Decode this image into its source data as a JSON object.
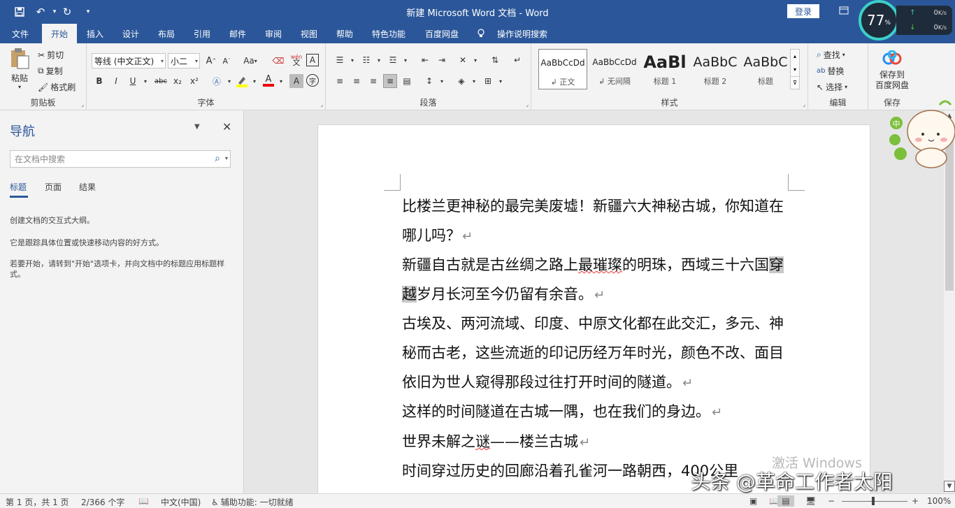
{
  "titlebar": {
    "title": "新建 Microsoft Word 文档  -  Word",
    "login_label": "登录",
    "qa_icons": [
      "save-icon",
      "undo-icon",
      "redo-icon",
      "customize-icon"
    ]
  },
  "speed_widget": {
    "value": "77",
    "unit": "%",
    "upload": "0",
    "upload_unit": "K/s",
    "download": "0",
    "download_unit": "K/s"
  },
  "tabs": [
    {
      "label": "文件"
    },
    {
      "label": "开始",
      "active": true
    },
    {
      "label": "插入"
    },
    {
      "label": "设计"
    },
    {
      "label": "布局"
    },
    {
      "label": "引用"
    },
    {
      "label": "邮件"
    },
    {
      "label": "审阅"
    },
    {
      "label": "视图"
    },
    {
      "label": "帮助"
    },
    {
      "label": "特色功能"
    },
    {
      "label": "百度网盘"
    },
    {
      "label": "操作说明搜索"
    }
  ],
  "ribbon": {
    "clipboard": {
      "group_label": "剪贴板",
      "paste": "粘贴",
      "cut": "剪切",
      "copy": "复制",
      "format_painter": "格式刷"
    },
    "font": {
      "group_label": "字体",
      "font_name": "等线 (中文正文)",
      "font_size": "小二",
      "change_case": "Aa",
      "bold": "B",
      "italic": "I",
      "underline": "U",
      "strike": "abc",
      "sub": "x₂",
      "sup": "x²",
      "grow": "A",
      "shrink": "A",
      "phonetic": "wén",
      "border_char": "A"
    },
    "paragraph": {
      "group_label": "段落"
    },
    "styles": {
      "group_label": "样式",
      "items": [
        {
          "sample": "AaBbCcDd",
          "name": "↲ 正文"
        },
        {
          "sample": "AaBbCcDd",
          "name": "↲ 无间隔"
        },
        {
          "sample": "AaBl",
          "name": "标题 1"
        },
        {
          "sample": "AaBbC",
          "name": "标题 2"
        },
        {
          "sample": "AaBbC",
          "name": "标题"
        }
      ]
    },
    "editing": {
      "group_label": "编辑",
      "find": "查找",
      "replace": "替换",
      "select": "选择"
    },
    "save": {
      "group_label": "保存",
      "button": "保存到\n百度网盘",
      "line1": "保存到",
      "line2": "百度网盘"
    }
  },
  "nav": {
    "title": "导航",
    "search_placeholder": "在文档中搜索",
    "tabs": [
      "标题",
      "页面",
      "结果"
    ],
    "p1": "创建文档的交互式大纲。",
    "p2": "它是跟踪具体位置或快速移动内容的好方式。",
    "p3": "若要开始，请转到\"开始\"选项卡，并向文档中的标题应用标题样式。"
  },
  "document": {
    "p1": "比楼兰更神秘的最完美废墟！新疆六大神秘古城，你知道在哪儿吗？",
    "p2a": "新疆自古就是古丝绸之路上",
    "p2b": "最璀璨",
    "p2c": "的明珠，西域三十六国",
    "p2d": "穿越",
    "p2e": "岁月长河至今仍留有余音。",
    "p3": "古埃及、两河流域、印度、中原文化都在此交汇，多元、神秘而古老，这些流逝的印记历经万年时光，颜色不改、面目依旧为世人窥得那段过往打开时间的隧道。",
    "p4": "这样的时间隧道在古城一隅，也在我们的身边。",
    "p5a": "世界未解之",
    "p5b": "谜",
    "p5c": "——楼兰古城",
    "p6": "时间穿过历史的回廊沿着孔雀河一路朝西，400公里",
    "para_mark": "↵"
  },
  "watermark": "激活 Windows",
  "brandmark": "头条 @革命工作者太阳",
  "status": {
    "page": "第 1 页，共 1 页",
    "words": "2/366 个字",
    "lang": "中文(中国)",
    "accessibility": "辅助功能: 一切就绪",
    "zoom": "100%",
    "zoom_minus": "−",
    "zoom_plus": "+"
  },
  "colors": {
    "brand": "#2b579a",
    "ribbon_bg": "#f3f3f3",
    "highlight": "#c8c8c8"
  }
}
